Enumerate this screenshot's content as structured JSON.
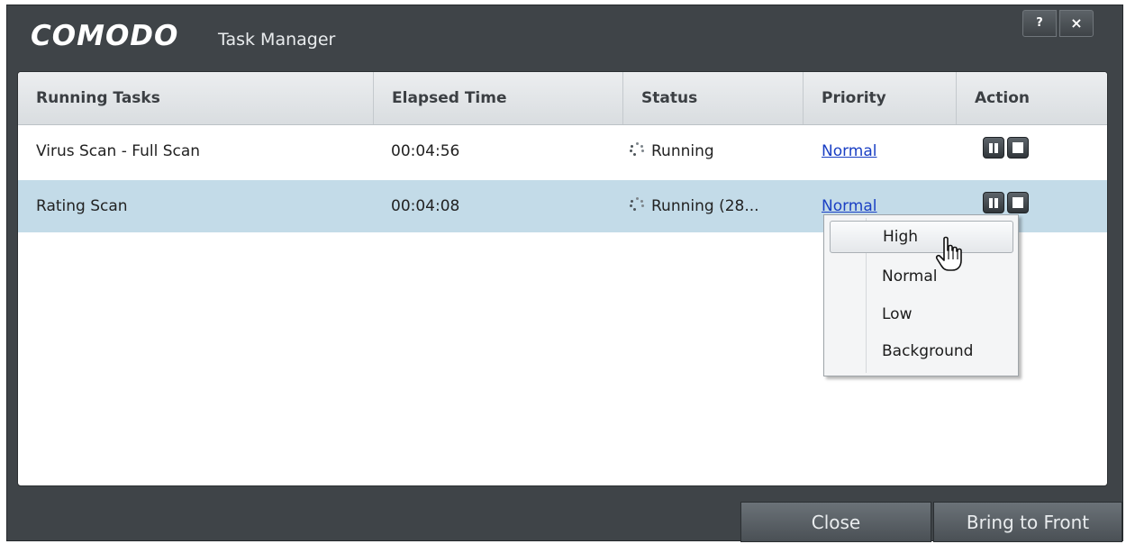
{
  "window": {
    "brand": "COMODO",
    "title": "Task Manager",
    "help_label": "?",
    "close_label": "×"
  },
  "table": {
    "columns": [
      "Running Tasks",
      "Elapsed Time",
      "Status",
      "Priority",
      "Action"
    ],
    "rows": [
      {
        "task": "Virus Scan - Full Scan",
        "elapsed": "00:04:56",
        "status": "Running",
        "priority": "Normal",
        "selected": false
      },
      {
        "task": "Rating Scan",
        "elapsed": "00:04:08",
        "status": "Running (28...",
        "priority": "Normal",
        "selected": true
      }
    ]
  },
  "priority_menu": {
    "items": [
      "High",
      "Normal",
      "Low",
      "Background"
    ],
    "hovered": "High"
  },
  "footer": {
    "close_label": "Close",
    "bring_label": "Bring to Front"
  },
  "colors": {
    "window_bg": "#3f4448",
    "selected_row": "#c3dbe8",
    "link": "#1a3fc4"
  },
  "icons": {
    "status": "loading-spinner-icon",
    "pause": "pause-icon",
    "stop": "stop-icon",
    "cursor": "hand-pointer-icon"
  }
}
